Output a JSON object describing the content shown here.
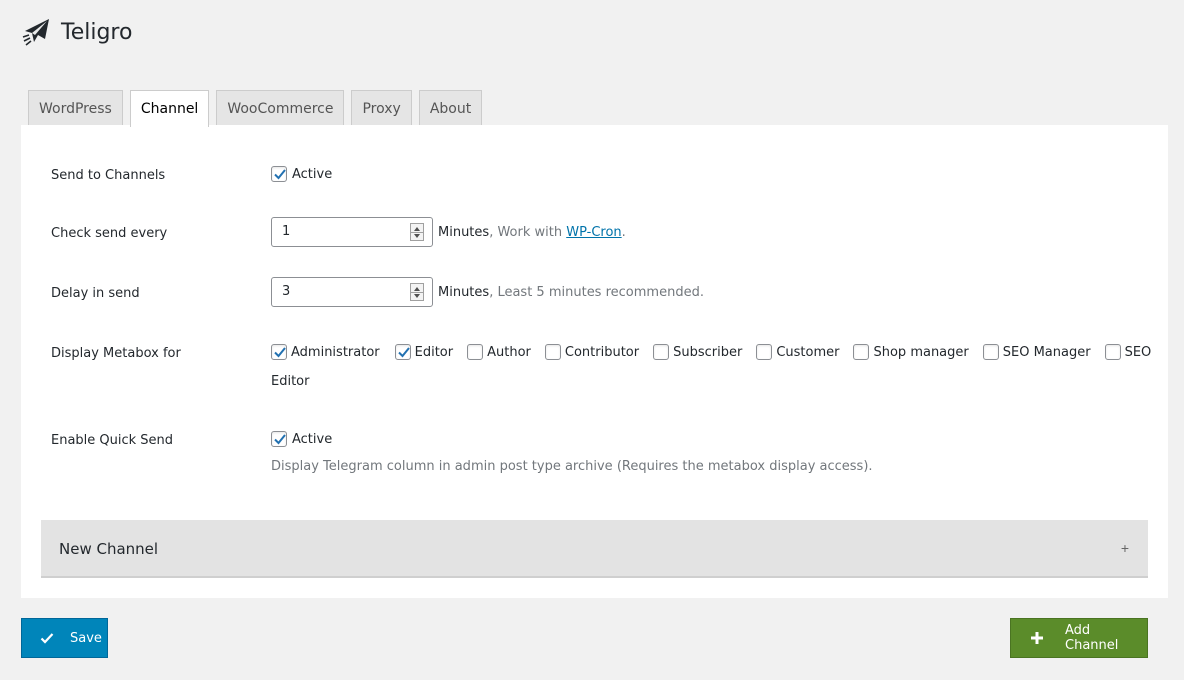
{
  "app": {
    "title": "Teligro",
    "logo_icon": "paper-plane-icon"
  },
  "tabs": [
    {
      "label": "WordPress",
      "active": false
    },
    {
      "label": "Channel",
      "active": true
    },
    {
      "label": "WooCommerce",
      "active": false
    },
    {
      "label": "Proxy",
      "active": false
    },
    {
      "label": "About",
      "active": false
    }
  ],
  "settings": {
    "send_to_channels": {
      "label": "Send to Channels",
      "checkbox_label": "Active",
      "checked": true
    },
    "check_send_every": {
      "label": "Check send every",
      "value": "1",
      "unit": "Minutes",
      "note_prefix": ", Work with ",
      "link": "WP-Cron",
      "note_suffix": "."
    },
    "delay_in_send": {
      "label": "Delay in send",
      "value": "3",
      "unit": "Minutes",
      "note": ", Least 5 minutes recommended."
    },
    "display_metabox": {
      "label": "Display Metabox for",
      "roles": [
        {
          "label": "Administrator",
          "checked": true
        },
        {
          "label": "Editor",
          "checked": true
        },
        {
          "label": "Author",
          "checked": false
        },
        {
          "label": "Contributor",
          "checked": false
        },
        {
          "label": "Subscriber",
          "checked": false
        },
        {
          "label": "Customer",
          "checked": false
        },
        {
          "label": "Shop manager",
          "checked": false
        },
        {
          "label": "SEO Manager",
          "checked": false
        },
        {
          "label": "SEO",
          "checked": false
        }
      ],
      "wrap_text": "Editor"
    },
    "enable_quick_send": {
      "label": "Enable Quick Send",
      "checkbox_label": "Active",
      "checked": true,
      "description": "Display Telegram column in admin post type archive (Requires the metabox display access)."
    }
  },
  "accordion": {
    "title": "New Channel",
    "toggle": "+"
  },
  "buttons": {
    "save": {
      "label": "Save",
      "icon": "check-icon",
      "color": "#0085ba"
    },
    "add_channel": {
      "label": "Add Channel",
      "icon": "plus-icon",
      "color": "#5b8c2a"
    }
  }
}
